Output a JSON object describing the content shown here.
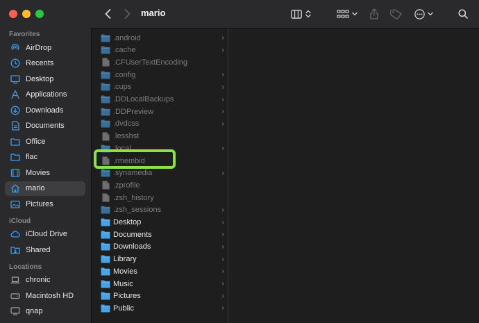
{
  "window": {
    "title": "mario"
  },
  "colors": {
    "accent": "#3d9cf0",
    "highlight": "#8ee04a",
    "close": "#ff5f57",
    "minimize": "#febc2e",
    "zoom": "#28c840"
  },
  "sidebar": {
    "sections": [
      {
        "title": "Favorites",
        "items": [
          {
            "label": "AirDrop",
            "icon": "airdrop-icon"
          },
          {
            "label": "Recents",
            "icon": "clock-icon"
          },
          {
            "label": "Desktop",
            "icon": "desktop-icon"
          },
          {
            "label": "Applications",
            "icon": "applications-icon"
          },
          {
            "label": "Downloads",
            "icon": "download-icon"
          },
          {
            "label": "Documents",
            "icon": "document-icon"
          },
          {
            "label": "Office",
            "icon": "folder-icon"
          },
          {
            "label": "flac",
            "icon": "folder-icon"
          },
          {
            "label": "Movies",
            "icon": "film-icon"
          },
          {
            "label": "mario",
            "icon": "home-icon",
            "selected": true
          },
          {
            "label": "Pictures",
            "icon": "photo-icon"
          }
        ]
      },
      {
        "title": "iCloud",
        "items": [
          {
            "label": "iCloud Drive",
            "icon": "cloud-icon"
          },
          {
            "label": "Shared",
            "icon": "shared-folder-icon"
          }
        ]
      },
      {
        "title": "Locations",
        "items": [
          {
            "label": "chronic",
            "icon": "laptop-icon"
          },
          {
            "label": "Macintosh HD",
            "icon": "disk-icon"
          },
          {
            "label": "qnap",
            "icon": "display-icon"
          }
        ]
      }
    ]
  },
  "column1": {
    "items": [
      {
        "name": ".android",
        "type": "folder",
        "hidden": true,
        "chevron": true
      },
      {
        "name": ".cache",
        "type": "folder",
        "hidden": true,
        "chevron": true
      },
      {
        "name": ".CFUserTextEncoding",
        "type": "file",
        "hidden": true,
        "chevron": false
      },
      {
        "name": ".config",
        "type": "folder",
        "hidden": true,
        "chevron": true
      },
      {
        "name": ".cups",
        "type": "folder",
        "hidden": true,
        "chevron": true
      },
      {
        "name": ".DDLocalBackups",
        "type": "folder",
        "hidden": true,
        "chevron": true
      },
      {
        "name": ".DDPreview",
        "type": "folder",
        "hidden": true,
        "chevron": true
      },
      {
        "name": ".dvdcss",
        "type": "folder",
        "hidden": true,
        "chevron": true
      },
      {
        "name": ".lesshst",
        "type": "file",
        "hidden": true,
        "chevron": false
      },
      {
        "name": ".local",
        "type": "folder",
        "hidden": true,
        "chevron": true
      },
      {
        "name": ".rmembid",
        "type": "file",
        "hidden": true,
        "chevron": false
      },
      {
        "name": ".synamedia",
        "type": "folder",
        "hidden": true,
        "chevron": true
      },
      {
        "name": ".zprofile",
        "type": "file",
        "hidden": true,
        "chevron": false
      },
      {
        "name": ".zsh_history",
        "type": "file",
        "hidden": true,
        "chevron": false
      },
      {
        "name": ".zsh_sessions",
        "type": "folder",
        "hidden": true,
        "chevron": true
      },
      {
        "name": "Desktop",
        "type": "folder",
        "hidden": false,
        "chevron": true
      },
      {
        "name": "Documents",
        "type": "folder",
        "hidden": false,
        "chevron": true
      },
      {
        "name": "Downloads",
        "type": "folder",
        "hidden": false,
        "chevron": true
      },
      {
        "name": "Library",
        "type": "folder",
        "hidden": false,
        "chevron": true
      },
      {
        "name": "Movies",
        "type": "folder",
        "hidden": false,
        "chevron": true
      },
      {
        "name": "Music",
        "type": "folder",
        "hidden": false,
        "chevron": true
      },
      {
        "name": "Pictures",
        "type": "folder",
        "hidden": false,
        "chevron": true
      },
      {
        "name": "Public",
        "type": "folder",
        "hidden": false,
        "chevron": true
      }
    ]
  }
}
